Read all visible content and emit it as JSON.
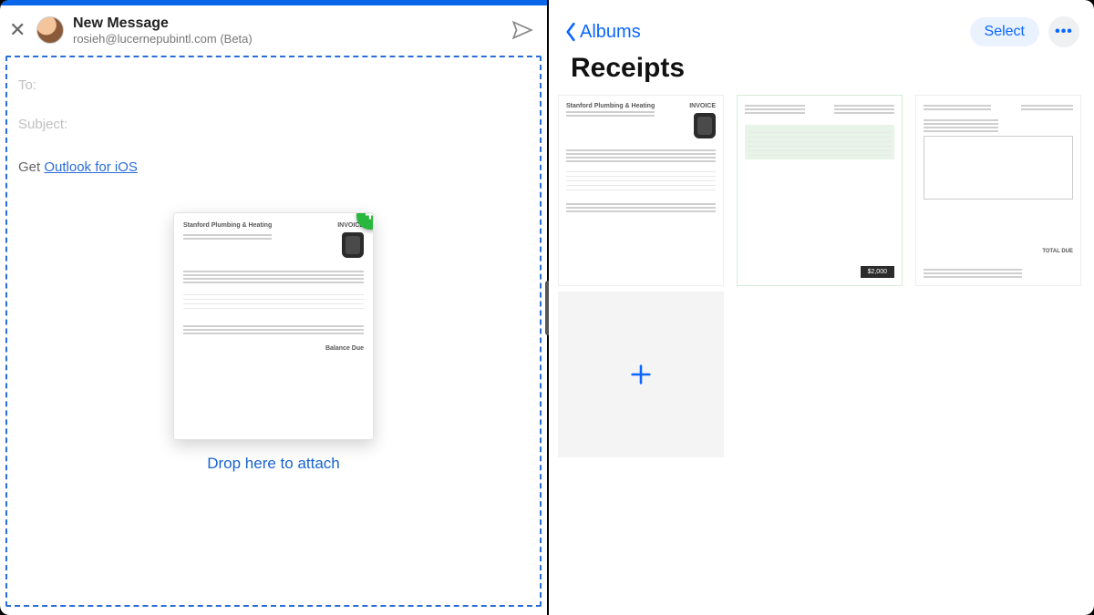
{
  "left": {
    "title": "New Message",
    "from": "rosieh@lucernepubintl.com (Beta)",
    "fields": {
      "to_label": "To:",
      "subject_label": "Subject:"
    },
    "body": {
      "prefix": "Get ",
      "link_text": "Outlook for iOS"
    },
    "drop_caption": "Drop here to attach",
    "drag_preview": {
      "company": "Stanford Plumbing & Heating",
      "doc_label": "INVOICE",
      "total_label": "Balance Due"
    }
  },
  "right": {
    "back_label": "Albums",
    "select_label": "Select",
    "album_title": "Receipts",
    "thumbs": [
      {
        "company": "Stanford Plumbing & Heating",
        "doc_label": "INVOICE"
      },
      {
        "total_badge": "$2,000"
      },
      {
        "total_label": "TOTAL DUE"
      }
    ]
  }
}
